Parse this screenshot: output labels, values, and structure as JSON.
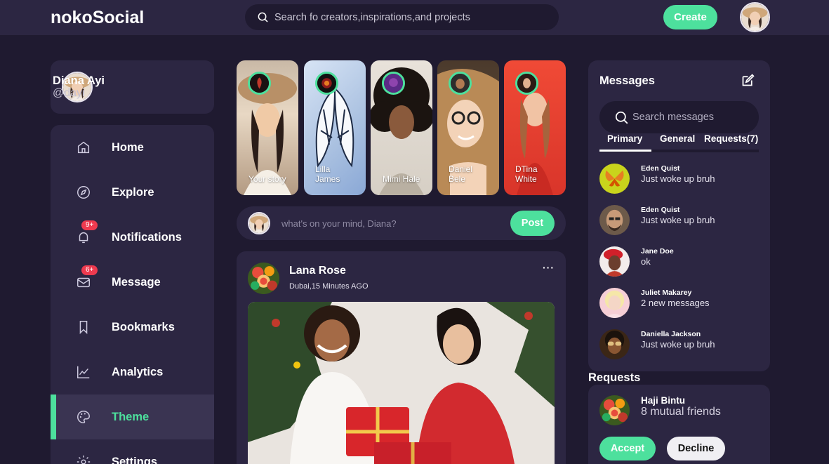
{
  "header": {
    "logo": "nokoSocial",
    "search_placeholder": "Search fo creators,inspirations,and projects",
    "create_label": "Create"
  },
  "profile": {
    "name": "Diana Ayi",
    "handle": "@dayi"
  },
  "sidebar": {
    "items": [
      {
        "label": "Home",
        "icon": "home-icon"
      },
      {
        "label": "Explore",
        "icon": "compass-icon"
      },
      {
        "label": "Notifications",
        "icon": "bell-icon",
        "badge": "9+"
      },
      {
        "label": "Message",
        "icon": "envelope-icon",
        "badge": "6+"
      },
      {
        "label": "Bookmarks",
        "icon": "bookmark-icon"
      },
      {
        "label": "Analytics",
        "icon": "chart-icon"
      },
      {
        "label": "Theme",
        "icon": "palette-icon",
        "active": true
      },
      {
        "label": "Settings",
        "icon": "gear-icon"
      }
    ]
  },
  "stories": [
    {
      "name": "Your story"
    },
    {
      "name": "Lilla James"
    },
    {
      "name": "Mimi Hale"
    },
    {
      "name": "Daniel Bele"
    },
    {
      "name": "DTina White"
    }
  ],
  "composer": {
    "placeholder": "what's on your mind, Diana?",
    "post_label": "Post"
  },
  "feed": {
    "author": "Lana Rose",
    "meta": "Dubai,15 Minutes AGO",
    "more": "···"
  },
  "messages": {
    "title": "Messages",
    "search_placeholder": "Search messages",
    "tabs": [
      {
        "label": "Primary",
        "active": true
      },
      {
        "label": "General"
      },
      {
        "label": "Requests(7)"
      }
    ],
    "items": [
      {
        "name": "Eden Quist",
        "text": "Just woke up bruh"
      },
      {
        "name": "Eden Quist",
        "text": "Just woke up bruh"
      },
      {
        "name": "Jane Doe",
        "text": "ok"
      },
      {
        "name": "Juliet Makarey",
        "text": "2 new messages"
      },
      {
        "name": "Daniella Jackson",
        "text": "Just woke up bruh"
      }
    ]
  },
  "requests": {
    "title": "Requests",
    "name": "Haji Bintu",
    "mutual": "8 mutual friends",
    "accept_label": "Accept",
    "decline_label": "Decline"
  },
  "colors": {
    "background": "#1f1a30",
    "panel": "#2c2642",
    "accent": "#4de09d",
    "badge": "#ee3a4f"
  }
}
